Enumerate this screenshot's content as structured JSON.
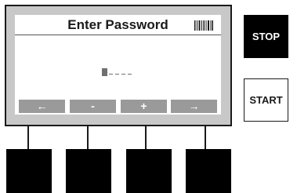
{
  "screen": {
    "title": "Enter Password",
    "title_icon": "barcode-icon",
    "password": {
      "cursor": "",
      "placeholder_count": 4
    },
    "softkeys": [
      {
        "label": "←",
        "icon": "arrow-left"
      },
      {
        "label": "-",
        "icon": "minus"
      },
      {
        "label": "+",
        "icon": "plus"
      },
      {
        "label": "→",
        "icon": "arrow-right"
      }
    ]
  },
  "side_buttons": {
    "stop_label": "STOP",
    "start_label": "START"
  },
  "colors": {
    "softkey_bg": "#9a9a9a",
    "bezel": "#c8c8c8",
    "hardware_key": "#000000"
  }
}
